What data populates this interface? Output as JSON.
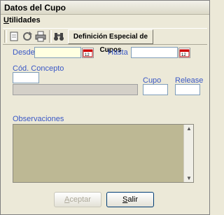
{
  "window": {
    "title": "Datos del Cupo"
  },
  "menu": {
    "utilidades_first": "U",
    "utilidades_rest": "tilidades"
  },
  "toolbar": {
    "definicion_label": "Definición Especial de Cupos"
  },
  "form": {
    "desde_label": "Desde",
    "hasta_label": "Hasta",
    "cod_concepto_label": "Cód. Concepto",
    "cupo_label": "Cupo",
    "release_label": "Release",
    "observaciones_label": "Observaciones",
    "desde_value": "",
    "hasta_value": "",
    "cod_concepto_value": "",
    "concepto_desc_value": "",
    "cupo_value": "",
    "release_value": "",
    "observaciones_value": ""
  },
  "buttons": {
    "aceptar_first": "A",
    "aceptar_rest": "ceptar",
    "salir_first": "S",
    "salir_rest": "alir"
  },
  "colors": {
    "label_blue": "#3a58c6",
    "obs_background": "#bdb894",
    "date_field": "#ffffe1"
  }
}
